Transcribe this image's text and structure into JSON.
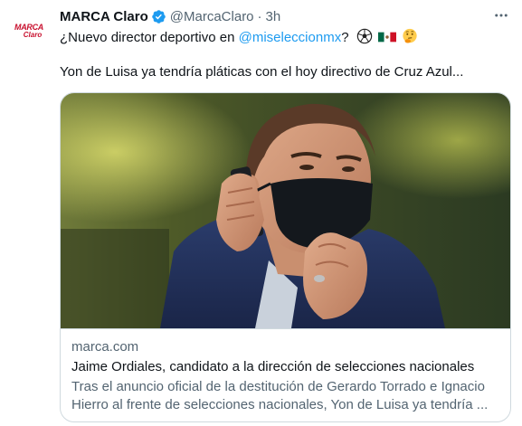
{
  "tweet": {
    "avatar": {
      "line1": "MARCA",
      "line2": "Claro"
    },
    "author_name": "MARCA Claro",
    "handle": "@MarcaClaro",
    "separator": "·",
    "time": "3h",
    "more_icon": "more-horizontal-icon",
    "text_line1_prefix": "¿Nuevo director deportivo en ",
    "mention": "@miseleccionmx",
    "text_line1_suffix": "?",
    "emojis": [
      "soccer-ball-emoji",
      "mexico-flag-emoji",
      "thinking-face-emoji"
    ],
    "text_line2": "Yon de Luisa ya tendría pláticas con el hoy directivo de Cruz Azul..."
  },
  "card": {
    "domain": "marca.com",
    "title": "Jaime Ordiales, candidato a la dirección de selecciones nacionales",
    "description_lines": [
      "Tras el anuncio oficial de la destitución de Gerardo Torrado e Ignacio",
      "Hierro al frente de selecciones nacionales, Yon de Luisa ya tendría ..."
    ]
  },
  "colors": {
    "accent": "#1d9bf0",
    "text": "#0f1419",
    "secondary": "#536471",
    "border": "#cfd9de",
    "brand": "#c8102e"
  }
}
